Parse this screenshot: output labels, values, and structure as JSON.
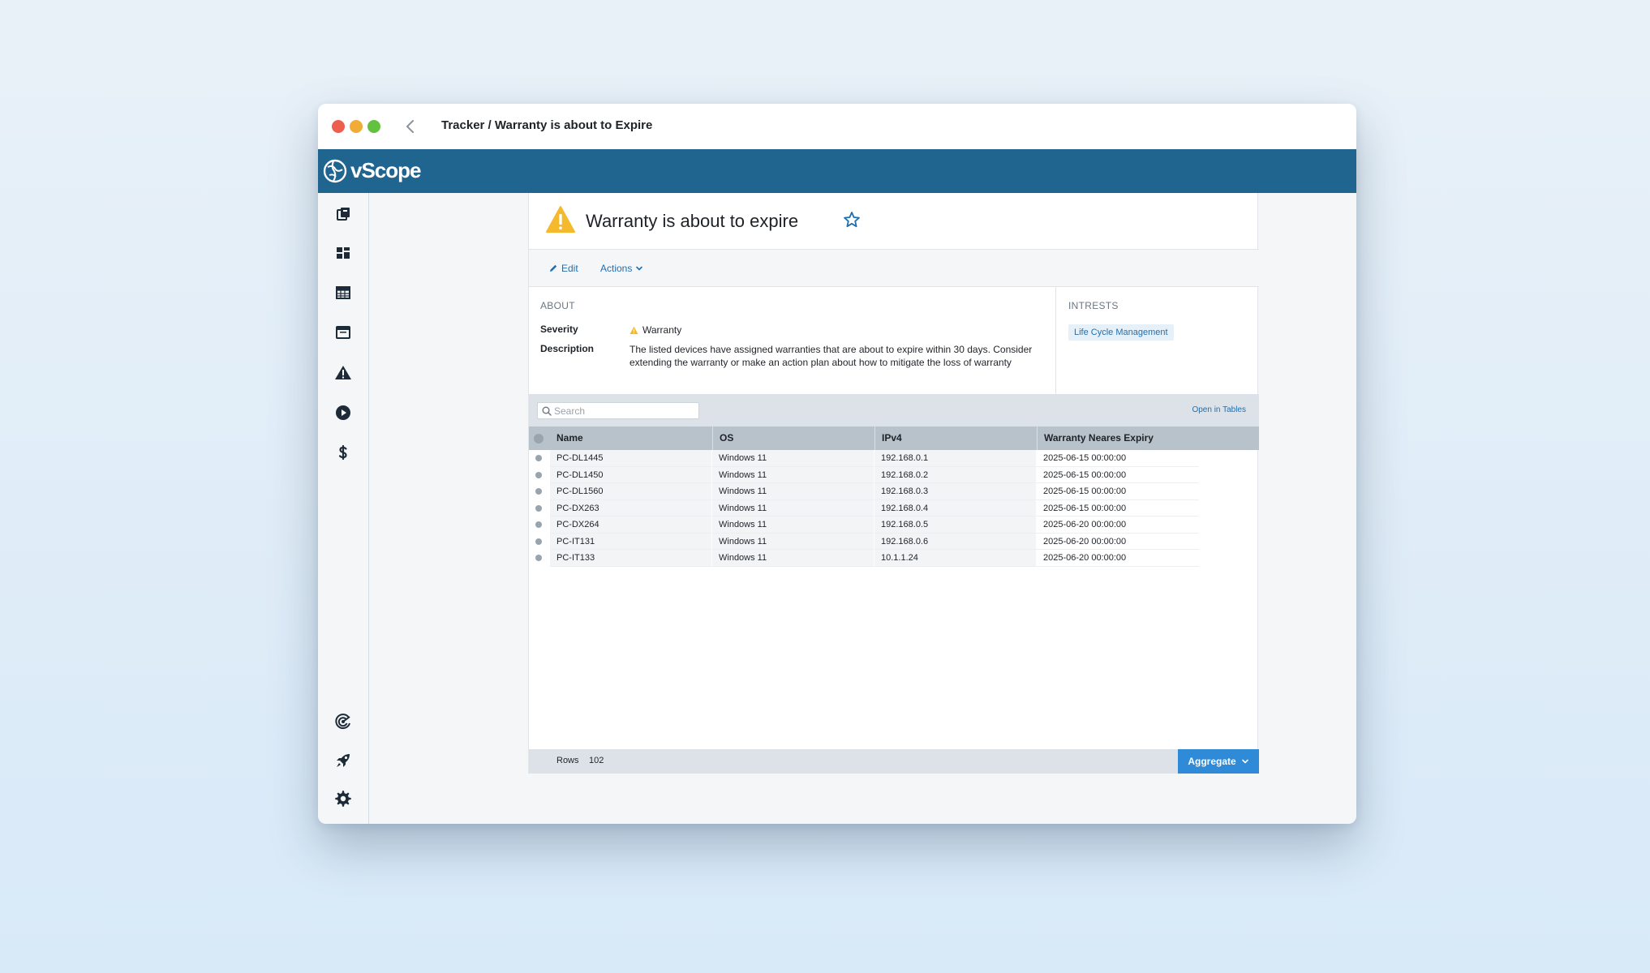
{
  "window": {
    "title": "Tracker / Warranty is about to Expire"
  },
  "app": {
    "brand": "vScope"
  },
  "sidebar": {
    "top_icons": [
      "library-icon",
      "dashboard-icon",
      "table-icon",
      "window-icon",
      "alert-icon",
      "play-icon",
      "dollar-icon"
    ],
    "bottom_icons": [
      "radar-icon",
      "rocket-icon",
      "gear-icon"
    ]
  },
  "header": {
    "title": "Warranty is about to expire"
  },
  "toolbar": {
    "edit_label": "Edit",
    "actions_label": "Actions"
  },
  "about": {
    "label": "ABOUT",
    "severity_label": "Severity",
    "severity_value": "Warranty",
    "description_label": "Description",
    "description_value": "The listed devices have assigned warranties that are about to expire within 30 days. Consider extending the warranty or make an action plan about how to mitigate the loss of warranty"
  },
  "interests": {
    "label": "INTRESTS",
    "tags": [
      "Life Cycle Management"
    ]
  },
  "search": {
    "placeholder": "Search",
    "value": ""
  },
  "open_in_tables": "Open in Tables",
  "table": {
    "columns": [
      "Name",
      "OS",
      "IPv4",
      "Warranty Neares Expiry"
    ],
    "rows": [
      [
        "PC-DL1445",
        "Windows 11",
        "192.168.0.1",
        "2025-06-15 00:00:00"
      ],
      [
        "PC-DL1450",
        "Windows 11",
        "192.168.0.2",
        "2025-06-15 00:00:00"
      ],
      [
        "PC-DL1560",
        "Windows 11",
        "192.168.0.3",
        "2025-06-15 00:00:00"
      ],
      [
        "PC-DX263",
        "Windows 11",
        "192.168.0.4",
        "2025-06-15 00:00:00"
      ],
      [
        "PC-DX264",
        "Windows 11",
        "192.168.0.5",
        "2025-06-20 00:00:00"
      ],
      [
        "PC-IT131",
        "Windows 11",
        "192.168.0.6",
        "2025-06-20 00:00:00"
      ],
      [
        "PC-IT133",
        "Windows 11",
        "10.1.1.24",
        "2025-06-20 00:00:00"
      ]
    ]
  },
  "footer": {
    "rows_label": "Rows",
    "rows_count": "102",
    "aggregate_label": "Aggregate"
  },
  "colors": {
    "appbar": "#1f6590",
    "accent": "#2f8ad8",
    "link": "#1f6fb0",
    "warning": "#f5b92e"
  }
}
